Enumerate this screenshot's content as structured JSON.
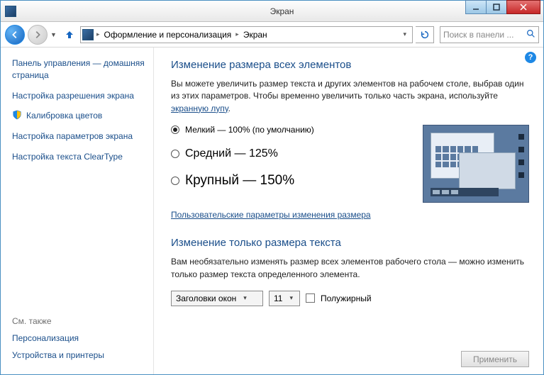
{
  "window": {
    "title": "Экран"
  },
  "breadcrumb": {
    "item1": "Оформление и персонализация",
    "item2": "Экран"
  },
  "search": {
    "placeholder": "Поиск в панели ..."
  },
  "sidebar": {
    "heading": "Панель управления — домашняя страница",
    "links": [
      "Настройка разрешения экрана",
      "Калибровка цветов",
      "Настройка параметров экрана",
      "Настройка текста ClearType"
    ],
    "seealso_heading": "См. также",
    "seealso": [
      "Персонализация",
      "Устройства и принтеры"
    ]
  },
  "main": {
    "heading1": "Изменение размера всех элементов",
    "para1_a": "Вы можете увеличить размер текста и других элементов на рабочем столе, выбрав один из этих параметров. Чтобы временно увеличить только часть экрана, используйте ",
    "para1_link": "экранную лупу",
    "para1_b": ".",
    "radios": {
      "small": "Мелкий — 100% (по умолчанию)",
      "medium": "Средний — 125%",
      "large": "Крупный — 150%"
    },
    "custom_link": "Пользовательские параметры изменения размера",
    "heading2": "Изменение только размера текста",
    "para2": "Вам необязательно изменять размер всех элементов рабочего стола — можно изменить только размер текста определенного элемента.",
    "combo_element": "Заголовки окон",
    "combo_size": "11",
    "bold_label": "Полужирный",
    "apply": "Применить"
  }
}
